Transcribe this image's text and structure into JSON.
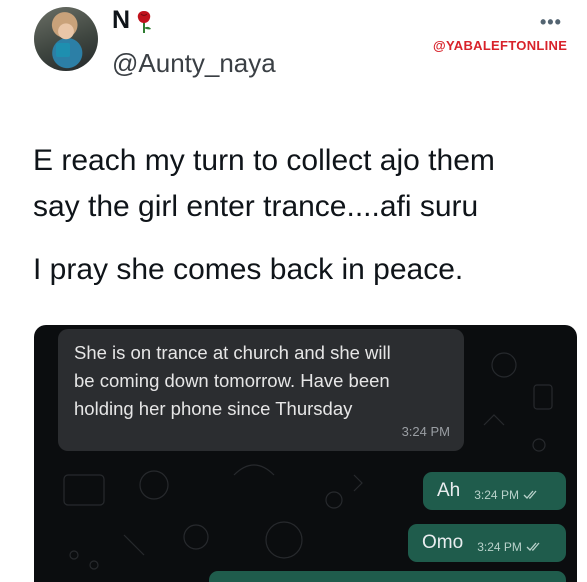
{
  "tweet": {
    "display_name": "N",
    "handle": "@Aunty_naya",
    "more": "•••",
    "watermark": "@YABALEFTONLINE",
    "lines": [
      "E reach my turn to collect ajo them",
      "say the girl enter trance....afi suru",
      "I pray she comes back in peace."
    ]
  },
  "chat": {
    "incoming": {
      "lines": [
        "She is on trance at church and she will",
        "be coming down tomorrow.  Have been",
        "holding her phone since Thursday"
      ],
      "time": "3:24 PM"
    },
    "outgoing": [
      {
        "text": "Ah",
        "time": "3:24 PM"
      },
      {
        "text": "Omo",
        "time": "3:24 PM"
      }
    ]
  },
  "colors": {
    "watermark": "#d8222a",
    "chat_background": "#0b0d0f",
    "incoming_bubble": "#2b2d30",
    "outgoing_bubble": "#1f5c4c",
    "rose": "#c0121c"
  },
  "icons": {
    "profile_badge": "rose-icon",
    "more": "more-icon",
    "read_receipt": "double-check-icon"
  }
}
